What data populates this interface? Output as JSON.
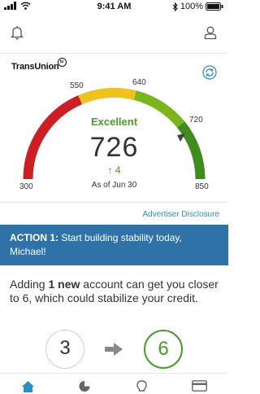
{
  "status": {
    "time": "9:41 AM",
    "battery": "100%"
  },
  "brand": {
    "name": "TransUnion",
    "mark": "tu"
  },
  "gauge": {
    "min_label": "300",
    "label_550": "550",
    "label_640": "640",
    "label_720": "720",
    "max_label": "850",
    "rating": "Excellent",
    "score": "726",
    "change": "4",
    "as_of": "As of Jun 30"
  },
  "disclosure": "Advertiser Disclosure",
  "action": {
    "title": "ACTION 1:",
    "text": "Start building stability today, Michael!"
  },
  "body": {
    "p1": "Adding ",
    "strong": "1 new",
    "p2": " account can get you closer to 6, which could stabilize your credit."
  },
  "progress": {
    "from": "3",
    "to": "6"
  },
  "icons": {
    "bell": "bell-icon",
    "user": "user-icon",
    "refresh": "refresh-icon",
    "home": "home-icon",
    "pie": "pie-chart-icon",
    "bulb": "lightbulb-icon",
    "card": "credit-card-icon"
  },
  "colors": {
    "green": "#4b9a2a",
    "blue": "#2f72a8",
    "link": "#2c8fc4"
  }
}
